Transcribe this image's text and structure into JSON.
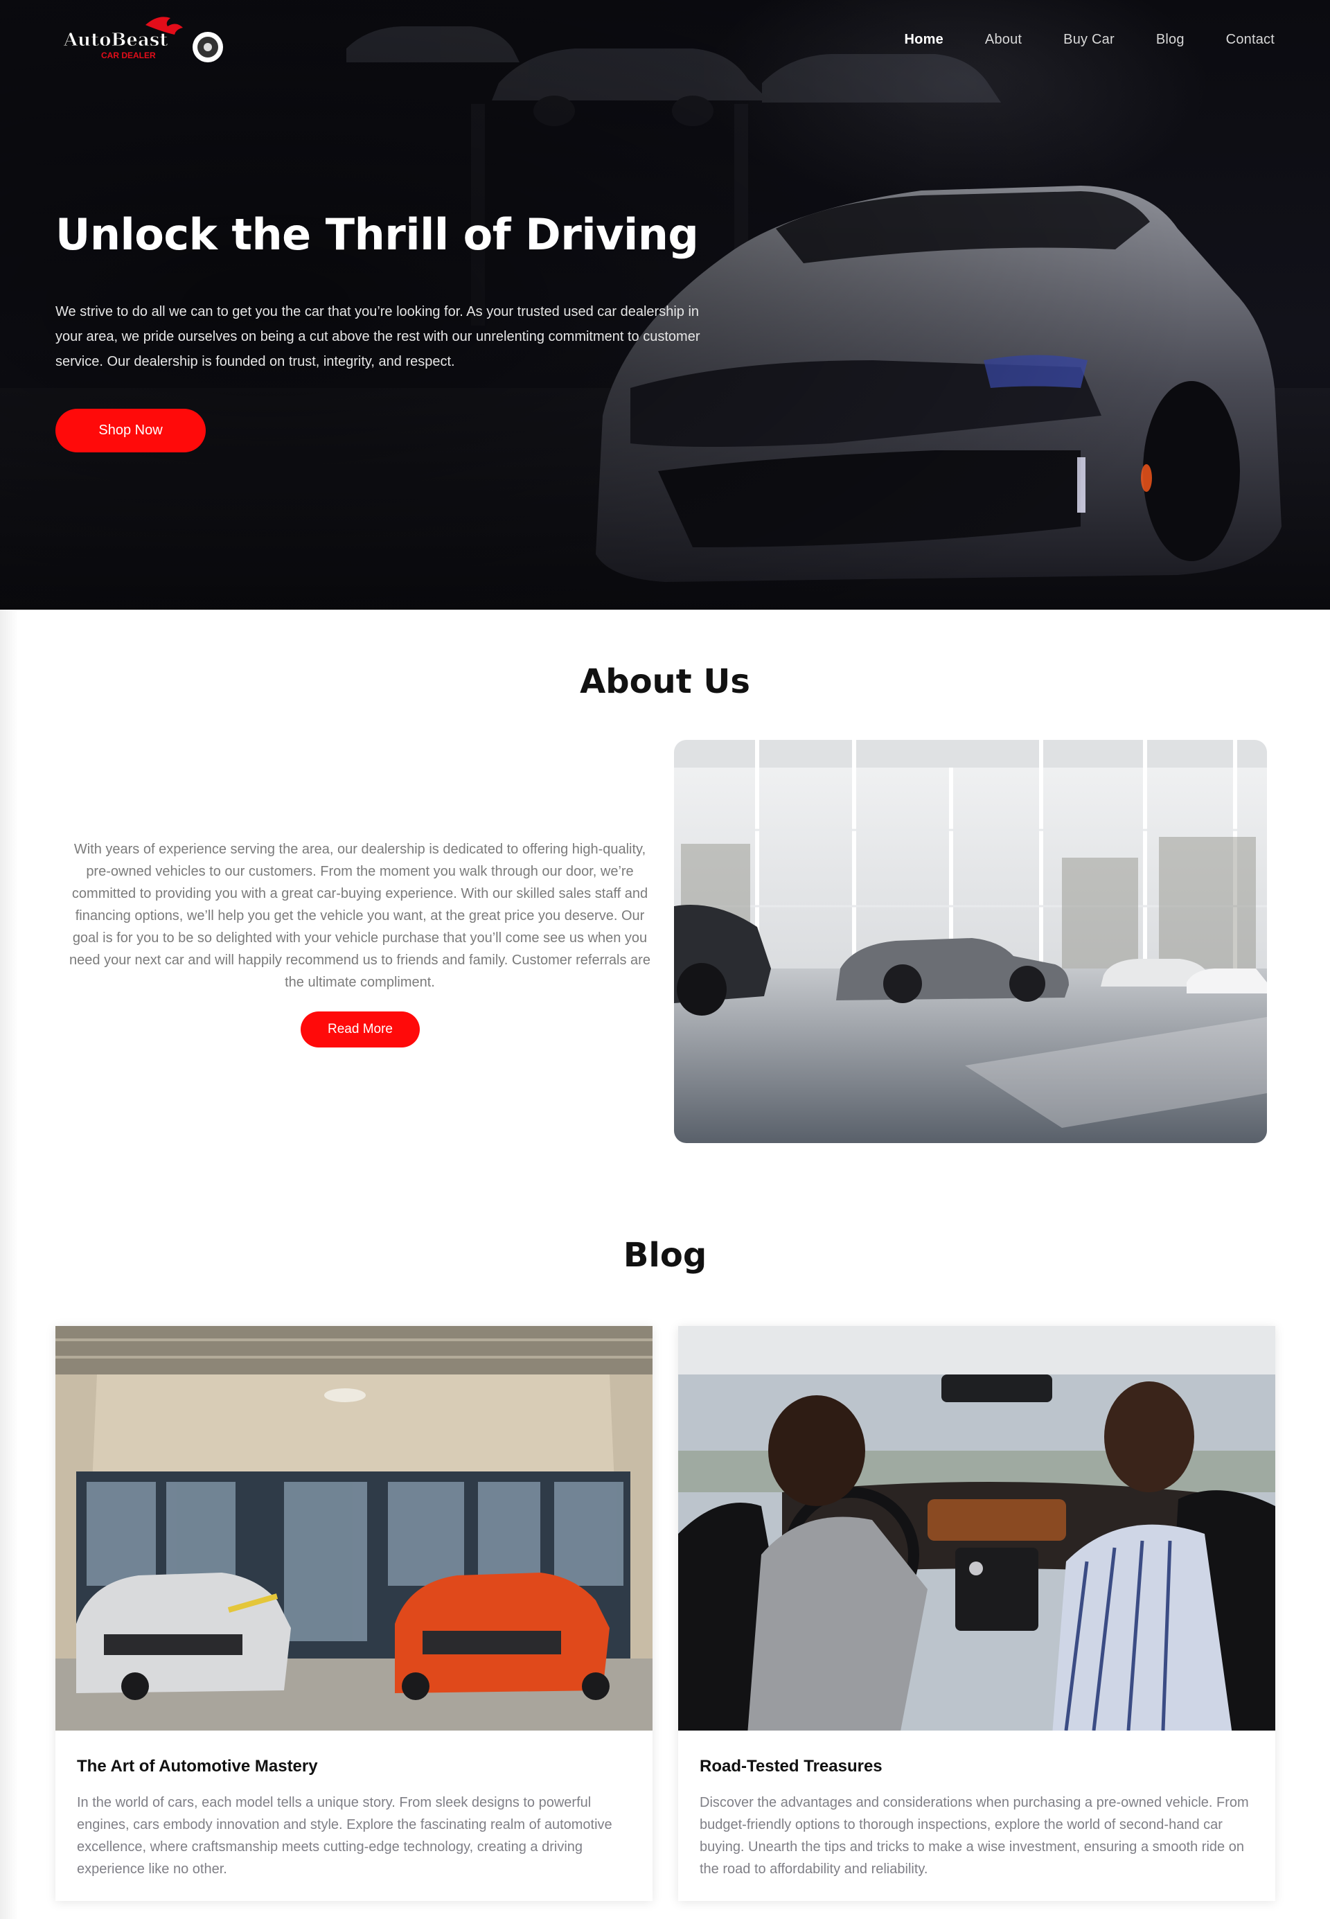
{
  "brand": {
    "name": "AutoBeast",
    "tagline": "CAR DEALER",
    "accent_color": "#ff0a0a"
  },
  "nav": {
    "items": [
      {
        "label": "Home",
        "active": true
      },
      {
        "label": "About",
        "active": false
      },
      {
        "label": "Buy Car",
        "active": false
      },
      {
        "label": "Blog",
        "active": false
      },
      {
        "label": "Contact",
        "active": false
      }
    ]
  },
  "hero": {
    "title": "Unlock the Thrill of Driving",
    "text": "We strive to do all we can to get you the car that you’re looking for. As your trusted used car dealership in your area, we pride ourselves on being a cut above the rest with our unrelenting commitment to customer service. Our dealership is founded on trust, integrity, and respect.",
    "button_label": "Shop Now"
  },
  "about": {
    "title": "About Us",
    "text": "With years of experience serving the area, our dealership is dedicated to offering high-quality, pre-owned vehicles to our customers. From the moment you walk through our door, we’re committed to providing you with a great car-buying experience. With our skilled sales staff and financing options, we’ll help you get the vehicle you want, at the great price you deserve. Our goal is for you to be so delighted with your vehicle purchase that you’ll come see us when you need your next car and will happily recommend us to friends and family. Customer referrals are the ultimate compliment.",
    "button_label": "Read More"
  },
  "blog": {
    "title": "Blog",
    "posts": [
      {
        "title": "The Art of Automotive Mastery",
        "text": "In the world of cars, each model tells a unique story. From sleek designs to powerful engines, cars embody innovation and style. Explore the fascinating realm of automotive excellence, where craftsmanship meets cutting-edge technology, creating a driving experience like no other."
      },
      {
        "title": "Road-Tested Treasures",
        "text": "Discover the advantages and considerations when purchasing a pre-owned vehicle. From budget-friendly options to thorough inspections, explore the world of second-hand car buying. Unearth the tips and tricks to make a wise investment, ensuring a smooth ride on the road to affordability and reliability."
      }
    ]
  }
}
